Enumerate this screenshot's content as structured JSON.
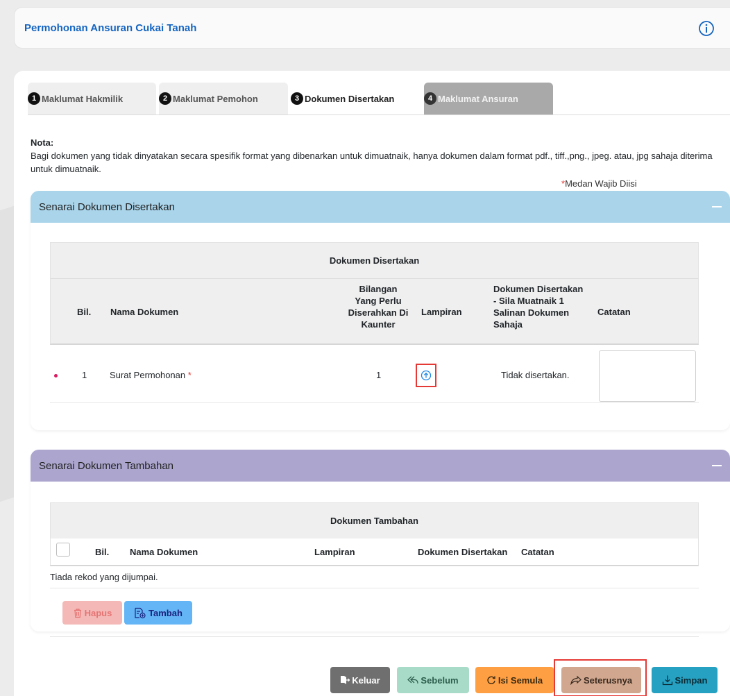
{
  "header": {
    "title": "Permohonan Ansuran Cukai Tanah"
  },
  "tabs": [
    {
      "num": "1",
      "label": "Maklumat Hakmilik"
    },
    {
      "num": "2",
      "label": "Maklumat Pemohon"
    },
    {
      "num": "3",
      "label": "Dokumen Disertakan"
    },
    {
      "num": "4",
      "label": "Maklumat Ansuran"
    }
  ],
  "nota": {
    "heading": "Nota:",
    "text": "Bagi dokumen yang tidak dinyatakan secara spesifik format yang dibenarkan untuk dimuatnaik, hanya dokumen dalam format pdf., tiff.,png., jpeg. atau, jpg sahaja diterima untuk dimuatnaik."
  },
  "wajib": {
    "star": "*",
    "text": "Medan Wajib Diisi"
  },
  "section1": {
    "title": "Senarai Dokumen Disertakan",
    "table_caption": "Dokumen Disertakan",
    "columns": {
      "bil": "Bil.",
      "nama": "Nama Dokumen",
      "bilangan_1": "Bilangan",
      "bilangan_2": "Yang Perlu",
      "bilangan_3": "Diserahkan Di",
      "bilangan_4": "Kaunter",
      "lampiran": "Lampiran",
      "disertakan_1": "Dokumen Disertakan",
      "disertakan_2": "- Sila Muatnaik 1",
      "disertakan_3": "Salinan Dokumen",
      "disertakan_4": "Sahaja",
      "catatan": "Catatan"
    },
    "rows": [
      {
        "bil": "1",
        "nama": "Surat Permohonan",
        "req": "*",
        "bilangan": "1",
        "status": "Tidak disertakan."
      }
    ]
  },
  "section2": {
    "title": "Senarai Dokumen Tambahan",
    "table_caption": "Dokumen Tambahan",
    "columns": {
      "bil": "Bil.",
      "nama": "Nama Dokumen",
      "lampiran": "Lampiran",
      "disertakan": "Dokumen Disertakan",
      "catatan": "Catatan"
    },
    "empty": "Tiada rekod yang dijumpai.",
    "buttons": {
      "hapus": "Hapus",
      "tambah": "Tambah"
    }
  },
  "footer": {
    "keluar": "Keluar",
    "sebelum": "Sebelum",
    "isi_semula": "Isi Semula",
    "seterusnya": "Seterusnya",
    "simpan": "Simpan"
  },
  "colors": {
    "title_blue": "#1565c0",
    "section1_head": "#a9d4ea",
    "section2_head": "#aca6cf",
    "highlight_red": "#e53935"
  }
}
